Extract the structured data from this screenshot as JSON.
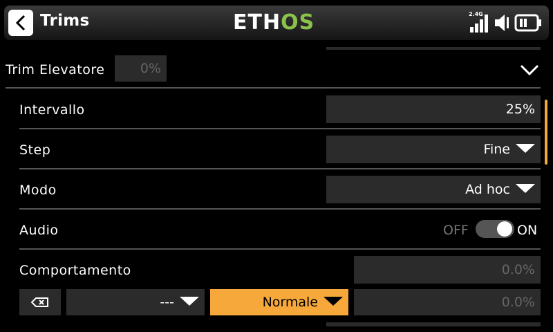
{
  "header": {
    "title": "Trims",
    "logo_part1": "ETH",
    "logo_part2": "OS",
    "band": "2.4G"
  },
  "trim_row": {
    "label": "Trim Elevatore",
    "value": "0%"
  },
  "rows": {
    "intervallo": {
      "label": "Intervallo",
      "value": "25%"
    },
    "step": {
      "label": "Step",
      "value": "Fine"
    },
    "modo": {
      "label": "Modo",
      "value": "Ad hoc"
    },
    "audio": {
      "label": "Audio",
      "off_label": "OFF",
      "on_label": "ON",
      "state": "on"
    },
    "comportamento": {
      "label": "Comportamento",
      "value1": "0.0%",
      "source": "---",
      "mode": "Normale",
      "value2": "0.0%"
    }
  },
  "colors": {
    "accent_orange": "#f6a83a",
    "logo_green": "#8bc34a",
    "field_bg": "#2b2b2b",
    "separator": "#555555"
  },
  "icons": [
    "back-arrow-icon",
    "signal-icon",
    "speaker-icon",
    "battery-icon",
    "clear-icon",
    "dropdown-caret-icon",
    "expand-chevron-icon"
  ]
}
